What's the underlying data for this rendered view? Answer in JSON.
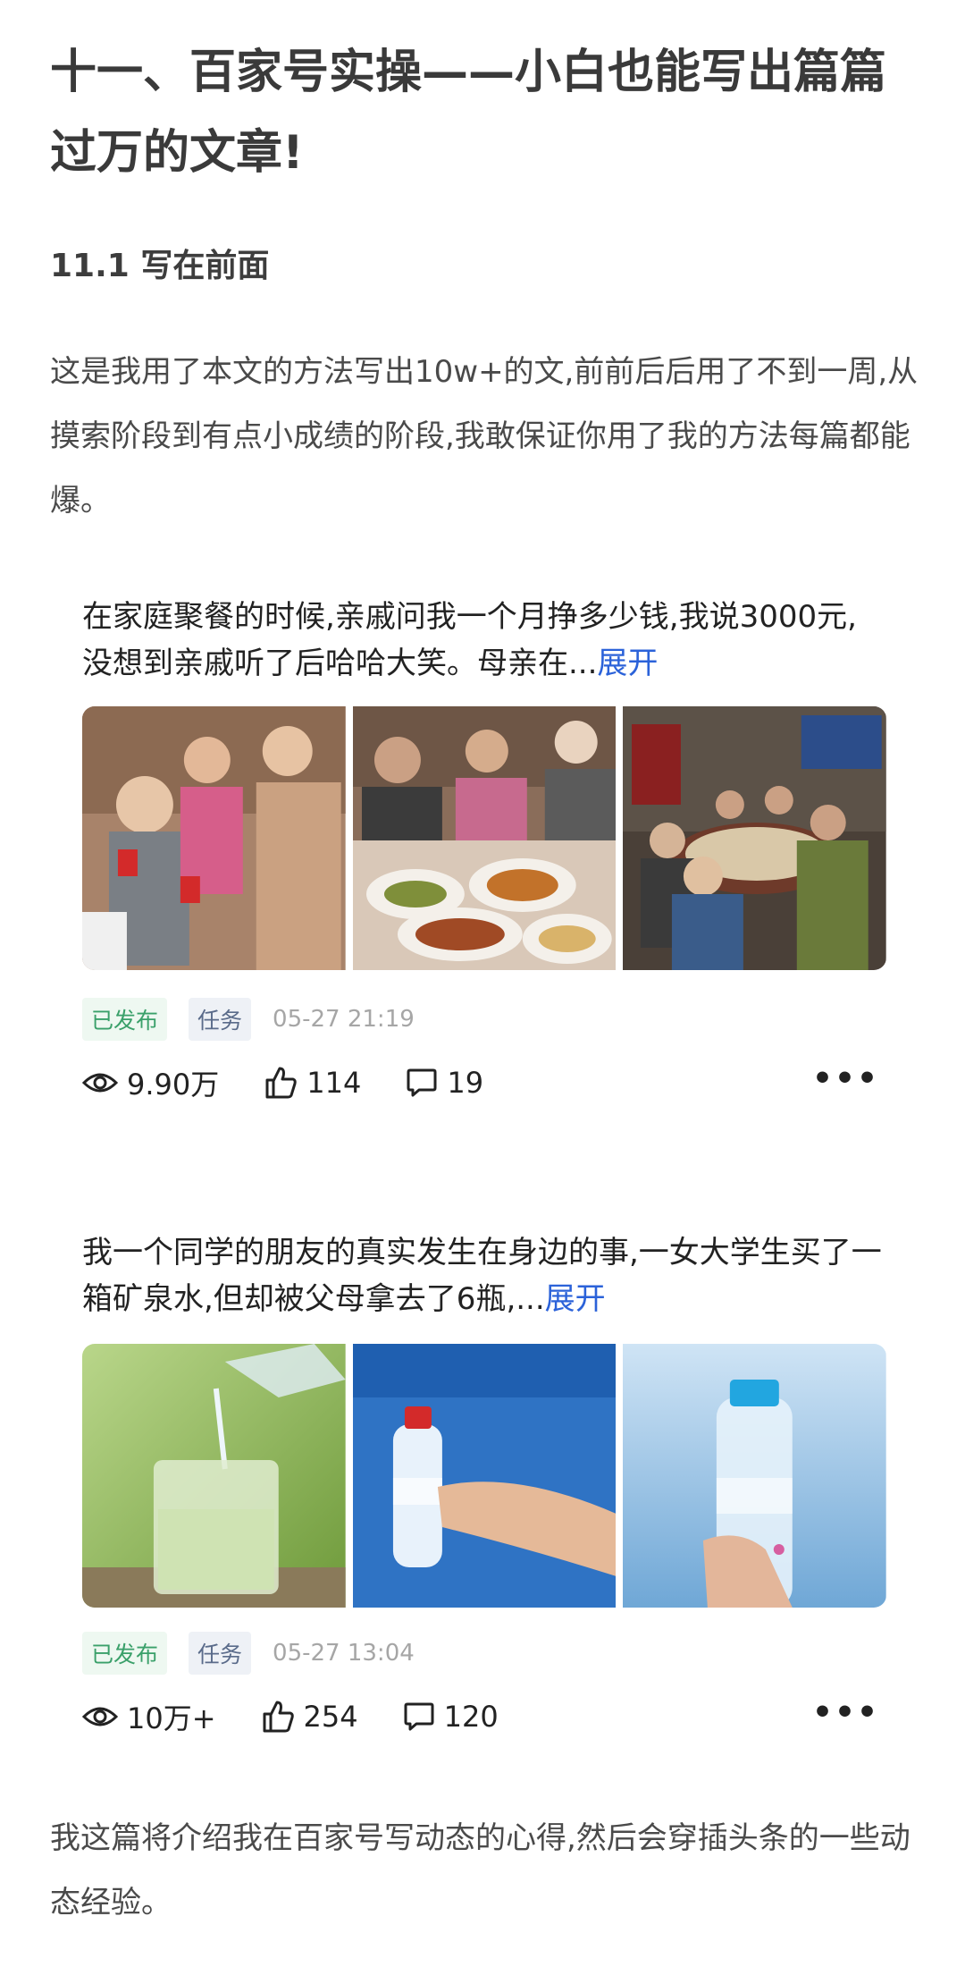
{
  "article": {
    "title": "十一、百家号实操——小白也能写出篇篇过万的文章!",
    "section_heading": "11.1 写在前面",
    "intro": "这是我用了本文的方法写出10w+的文,前前后后用了不到一周,从摸索阶段到有点小成绩的阶段,我敢保证你用了我的方法每篇都能爆。",
    "outro": "我这篇将介绍我在百家号写动态的心得,然后会穿插头条的一些动态经验。"
  },
  "posts": [
    {
      "text": "在家庭聚餐的时候,亲戚问我一个月挣多少钱,我说3000元,没想到亲戚听了后哈哈大笑。母亲在...",
      "expand": "展开",
      "status": "已发布",
      "type": "任务",
      "time": "05-27 21:19",
      "views": "9.90万",
      "likes": "114",
      "comments": "19",
      "more": "•••"
    },
    {
      "text": "我一个同学的朋友的真实发生在身边的事,一女大学生买了一箱矿泉水,但却被父母拿去了6瓶,...",
      "expand": "展开",
      "status": "已发布",
      "type": "任务",
      "time": "05-27 13:04",
      "views": "10万+",
      "likes": "254",
      "comments": "120",
      "more": "•••"
    }
  ]
}
